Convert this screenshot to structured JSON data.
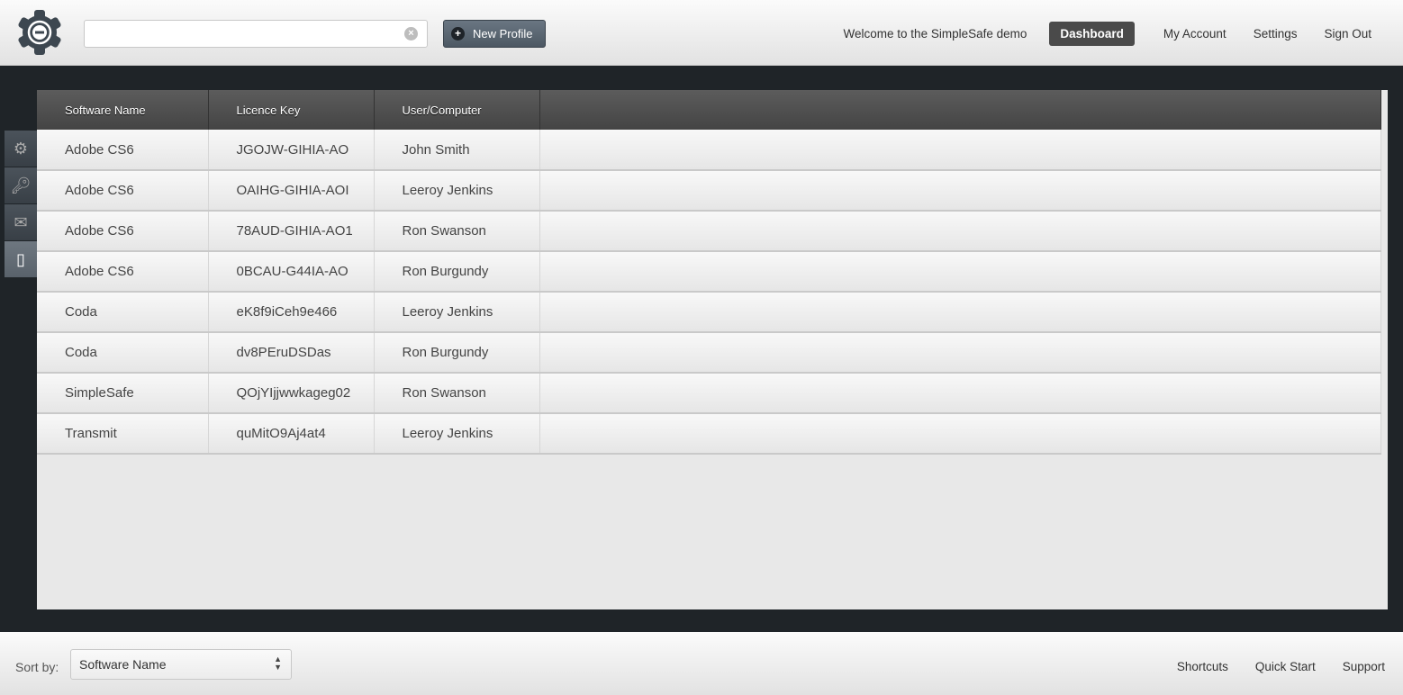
{
  "header": {
    "search": {
      "value": "",
      "placeholder": ""
    },
    "new_profile_label": "New Profile",
    "welcome": "Welcome to the SimpleSafe demo",
    "nav": [
      "Dashboard",
      "My Account",
      "Settings",
      "Sign Out"
    ],
    "active_nav": "Dashboard"
  },
  "sidebar": {
    "tabs": [
      "gear-icon",
      "key-icon",
      "envelope-icon",
      "notebook-icon"
    ],
    "active": "notebook-icon"
  },
  "table": {
    "columns": [
      "Software Name",
      "Licence Key",
      "User/Computer",
      ""
    ],
    "rows": [
      [
        "Adobe CS6",
        "JGOJW-GIHIA-AO",
        "John Smith"
      ],
      [
        "Adobe CS6",
        "OAIHG-GIHIA-AOI",
        "Leeroy Jenkins"
      ],
      [
        "Adobe CS6",
        "78AUD-GIHIA-AO1",
        "Ron Swanson"
      ],
      [
        "Adobe CS6",
        "0BCAU-G44IA-AO",
        "Ron Burgundy"
      ],
      [
        "Coda",
        "eK8f9iCeh9e466",
        "Leeroy Jenkins"
      ],
      [
        "Coda",
        "dv8PEruDSDas",
        "Ron Burgundy"
      ],
      [
        "SimpleSafe",
        "QOjYIjjwwkageg02",
        "Ron Swanson"
      ],
      [
        "Transmit",
        "quMitO9Aj4at4",
        "Leeroy Jenkins"
      ]
    ]
  },
  "footer": {
    "sort_label": "Sort by:",
    "sort_value": "Software Name",
    "links": [
      "Shortcuts",
      "Quick Start",
      "Support"
    ]
  },
  "colors": {
    "accent": "#4d5863",
    "background": "#1f2428"
  }
}
